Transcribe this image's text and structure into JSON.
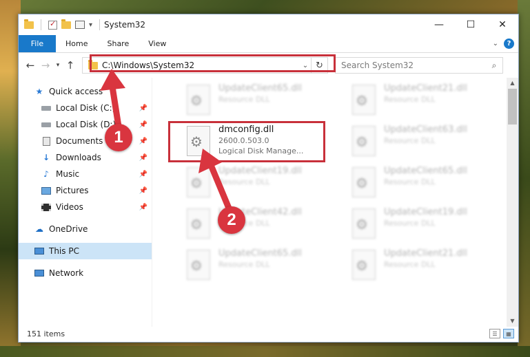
{
  "window": {
    "title": "System32",
    "controls": {
      "minimize": "—",
      "maximize": "☐",
      "close": "✕"
    }
  },
  "ribbon": {
    "tabs": [
      "File",
      "Home",
      "Share",
      "View"
    ]
  },
  "nav": {
    "address": "C:\\Windows\\System32",
    "search_placeholder": "Search System32"
  },
  "sidebar": {
    "items": [
      {
        "label": "Quick access"
      },
      {
        "label": "Local Disk (C:)"
      },
      {
        "label": "Local Disk (D:)"
      },
      {
        "label": "Documents"
      },
      {
        "label": "Downloads"
      },
      {
        "label": "Music"
      },
      {
        "label": "Pictures"
      },
      {
        "label": "Videos"
      },
      {
        "label": "OneDrive"
      },
      {
        "label": "This PC"
      },
      {
        "label": "Network"
      }
    ]
  },
  "files": {
    "highlighted": {
      "name": "dmconfig.dll",
      "version": "2600.0.503.0",
      "description": "Logical Disk Manage..."
    },
    "blurred": [
      {
        "name": "UpdateClient65.dll",
        "sub": "Resource DLL"
      },
      {
        "name": "UpdateClient21.dll",
        "sub": "Resource DLL"
      },
      {
        "name": "UpdateClient63.dll",
        "sub": "Resource DLL"
      },
      {
        "name": "UpdateClient19.dll",
        "sub": "Resource DLL"
      },
      {
        "name": "UpdateClient65.dll",
        "sub": "Resource DLL"
      },
      {
        "name": "UpdateClient42.dll",
        "sub": "Resource DLL"
      },
      {
        "name": "UpdateClient19.dll",
        "sub": "Resource DLL"
      },
      {
        "name": "UpdateClient65.dll",
        "sub": "Resource DLL"
      },
      {
        "name": "UpdateClient21.dll",
        "sub": "Resource DLL"
      }
    ]
  },
  "status": {
    "count": "151 items"
  },
  "annotations": {
    "step1": "1",
    "step2": "2",
    "accent": "#d9353f"
  }
}
